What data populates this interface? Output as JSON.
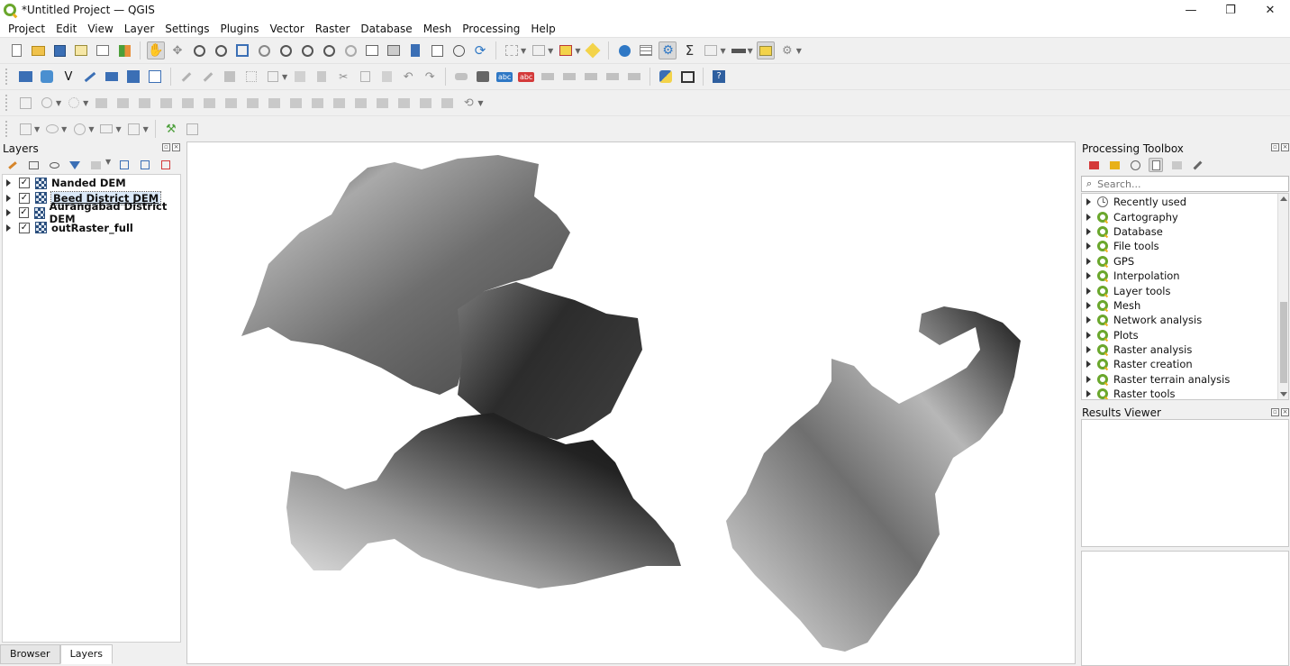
{
  "window": {
    "title": "*Untitled Project — QGIS",
    "controls": [
      "—",
      "❐",
      "✕"
    ]
  },
  "menu": [
    "Project",
    "Edit",
    "View",
    "Layer",
    "Settings",
    "Plugins",
    "Vector",
    "Raster",
    "Database",
    "Mesh",
    "Processing",
    "Help"
  ],
  "layers_panel": {
    "title": "Layers",
    "layers": [
      {
        "name": "Nanded DEM",
        "checked": true
      },
      {
        "name": "Beed District DEM",
        "checked": true,
        "selected": true
      },
      {
        "name": "Aurangabad District DEM",
        "checked": true
      },
      {
        "name": "outRaster_full",
        "checked": true
      }
    ],
    "bottom_tabs": [
      "Browser",
      "Layers"
    ]
  },
  "processing_toolbox": {
    "title": "Processing Toolbox",
    "search_placeholder": "Search...",
    "items": [
      {
        "label": "Recently used",
        "icon": "clock-icon"
      },
      {
        "label": "Cartography",
        "icon": "qgis-icon"
      },
      {
        "label": "Database",
        "icon": "qgis-icon"
      },
      {
        "label": "File tools",
        "icon": "qgis-icon"
      },
      {
        "label": "GPS",
        "icon": "qgis-icon"
      },
      {
        "label": "Interpolation",
        "icon": "qgis-icon"
      },
      {
        "label": "Layer tools",
        "icon": "qgis-icon"
      },
      {
        "label": "Mesh",
        "icon": "qgis-icon"
      },
      {
        "label": "Network analysis",
        "icon": "qgis-icon"
      },
      {
        "label": "Plots",
        "icon": "qgis-icon"
      },
      {
        "label": "Raster analysis",
        "icon": "qgis-icon"
      },
      {
        "label": "Raster creation",
        "icon": "qgis-icon"
      },
      {
        "label": "Raster terrain analysis",
        "icon": "qgis-icon"
      },
      {
        "label": "Raster tools",
        "icon": "qgis-icon"
      }
    ]
  },
  "results_viewer": {
    "title": "Results Viewer"
  },
  "colors": {
    "accent": "#6aa72c",
    "selection": "#dbe9f8"
  }
}
